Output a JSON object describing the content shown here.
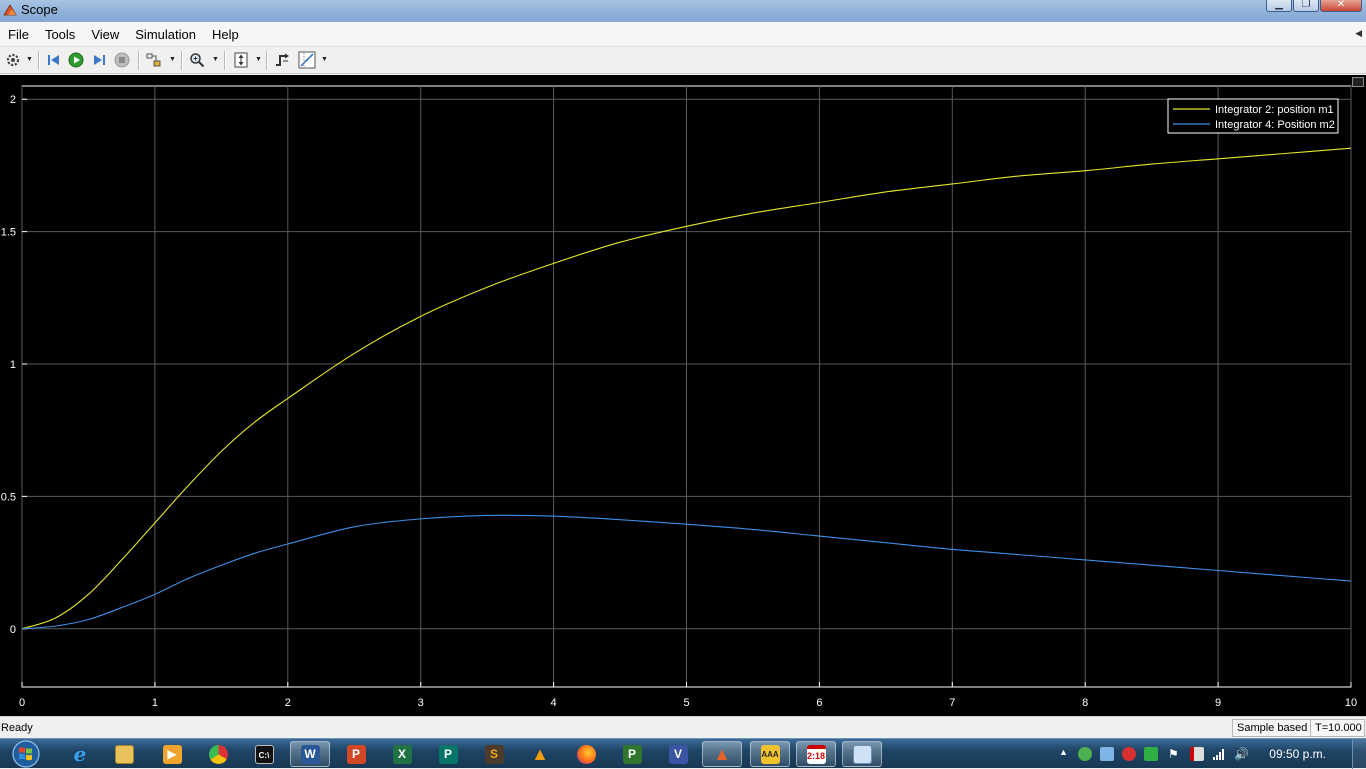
{
  "window": {
    "title": "Scope",
    "controls": [
      "minimize",
      "maximize",
      "close"
    ]
  },
  "menu": [
    "File",
    "Tools",
    "View",
    "Simulation",
    "Help"
  ],
  "toolbar": {
    "buttons": [
      "settings-icon",
      "step-back-icon",
      "run-icon",
      "step-forward-icon",
      "stop-icon",
      "highlight-block-icon",
      "zoom-icon",
      "autoscale-icon",
      "triggers-icon",
      "cursor-measurements-icon"
    ]
  },
  "chart_data": {
    "type": "line",
    "title": "",
    "xlabel": "",
    "ylabel": "",
    "xlim": [
      0,
      10
    ],
    "ylim": [
      -0.22,
      2.05
    ],
    "xticks": [
      0,
      1,
      2,
      3,
      4,
      5,
      6,
      7,
      8,
      9,
      10
    ],
    "xtick_labels": [
      "0",
      "1",
      "2",
      "3",
      "4",
      "5",
      "6",
      "7",
      "8",
      "9",
      "10"
    ],
    "yticks": [
      0,
      0.5,
      1,
      1.5,
      2
    ],
    "ytick_labels": [
      "0",
      "0.5",
      "1",
      "1.5",
      "2"
    ],
    "grid": true,
    "legend_position": "top-right",
    "background": "#000000",
    "grid_color": "#5a5a5a",
    "axis_color": "#ffffff",
    "series": [
      {
        "name": "Integrator 2: position m1",
        "color": "#e6e62a",
        "x": [
          0,
          0.25,
          0.5,
          0.75,
          1,
          1.25,
          1.5,
          1.75,
          2,
          2.5,
          3,
          3.5,
          4,
          4.5,
          5,
          5.5,
          6,
          6.5,
          7,
          7.5,
          8,
          8.5,
          9,
          9.5,
          10
        ],
        "values": [
          0,
          0.04,
          0.13,
          0.26,
          0.4,
          0.54,
          0.67,
          0.78,
          0.87,
          1.04,
          1.18,
          1.29,
          1.38,
          1.46,
          1.52,
          1.57,
          1.61,
          1.65,
          1.68,
          1.71,
          1.73,
          1.755,
          1.775,
          1.795,
          1.815
        ]
      },
      {
        "name": "Integrator 4: Position m2",
        "color": "#3c8fe6",
        "x": [
          0,
          0.25,
          0.5,
          0.75,
          1,
          1.25,
          1.5,
          1.75,
          2,
          2.5,
          3,
          3.5,
          4,
          4.5,
          5,
          5.5,
          6,
          6.5,
          7,
          7.5,
          8,
          8.5,
          9,
          9.5,
          10
        ],
        "values": [
          0,
          0.01,
          0.035,
          0.08,
          0.13,
          0.19,
          0.24,
          0.285,
          0.32,
          0.385,
          0.415,
          0.428,
          0.425,
          0.412,
          0.395,
          0.375,
          0.35,
          0.325,
          0.3,
          0.28,
          0.26,
          0.24,
          0.22,
          0.2,
          0.18
        ]
      }
    ]
  },
  "status": {
    "left": "Ready",
    "mode": "Sample based",
    "time": "T=10.000"
  },
  "taskbar": {
    "apps": [
      "ie-icon",
      "explorer-icon",
      "media-player-icon",
      "chrome-icon",
      "cmd-icon",
      "word-icon",
      "powerpoint-icon",
      "excel-icon",
      "publisher-icon",
      "sublime-icon",
      "vlc-icon",
      "firefox-icon",
      "project-icon",
      "visio-icon",
      "matlab-icon",
      "aaa-icon",
      "calendar-icon",
      "window-icon"
    ],
    "clock": "09:50 p.m."
  }
}
